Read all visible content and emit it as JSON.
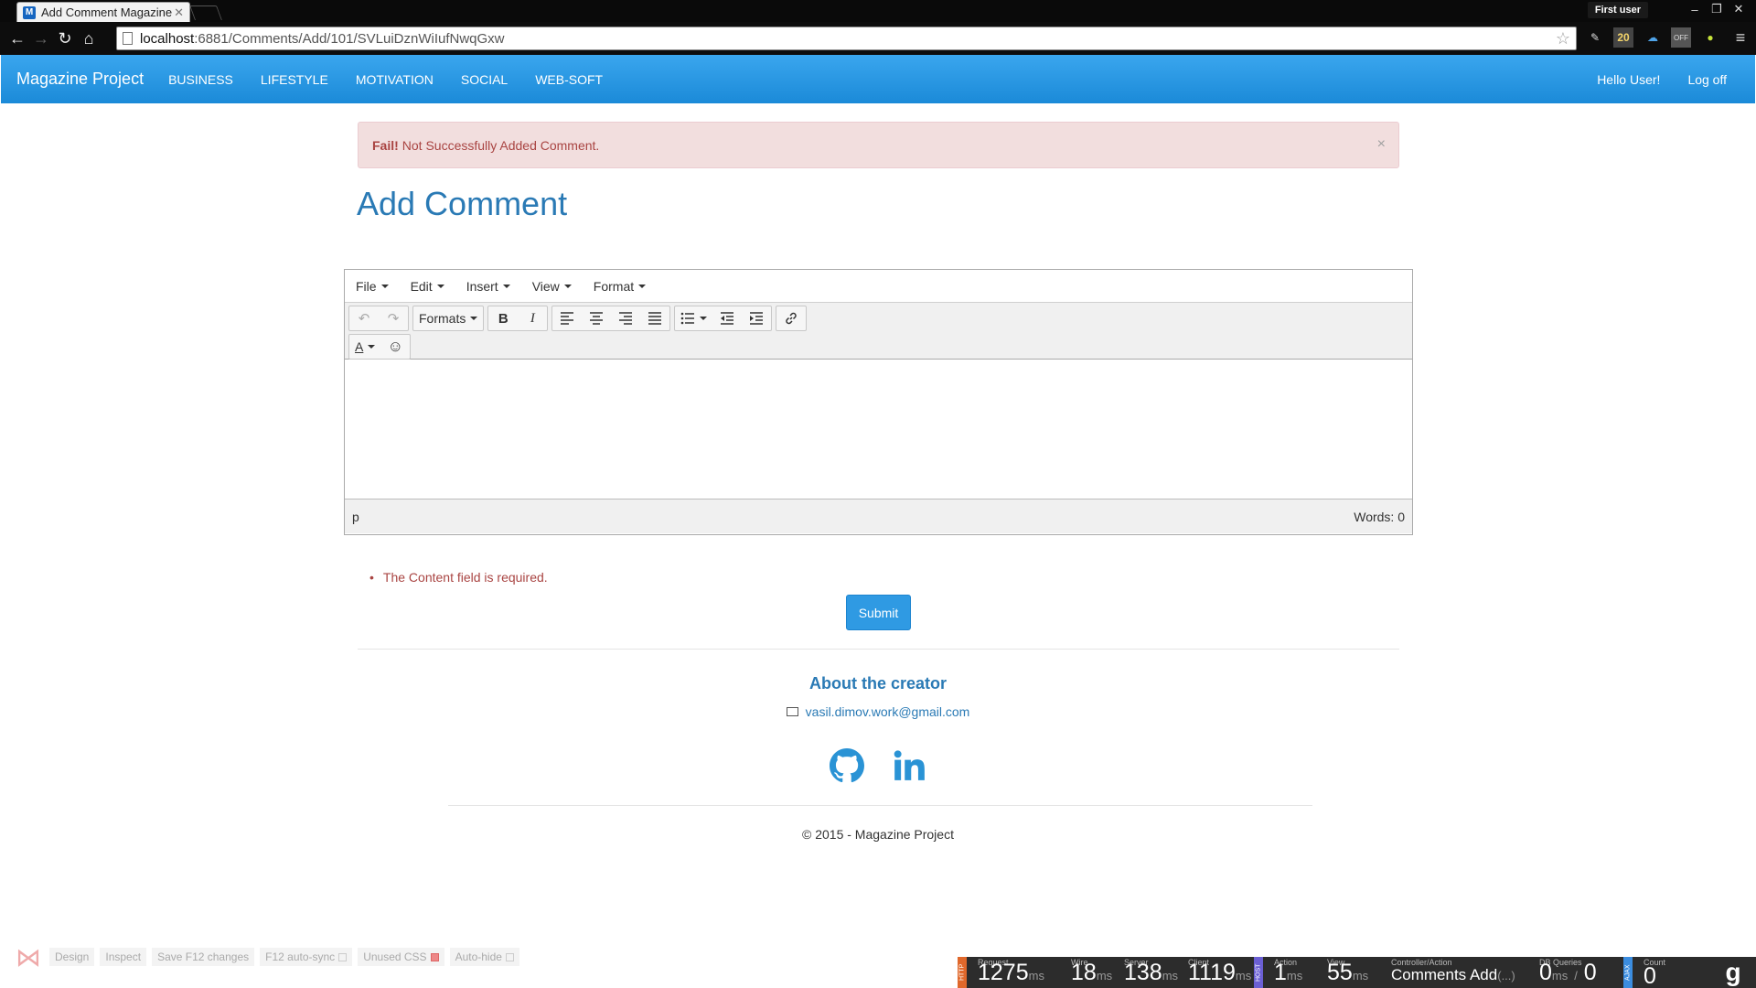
{
  "browser": {
    "tab_title": "Add Comment Magazine",
    "url_host": "localhost",
    "url_path": ":6881/Comments/Add/101/SVLuiDznWiIufNwqGxw",
    "user_badge": "First user",
    "ext_badge": "20",
    "ext_off": "OFF"
  },
  "nav": {
    "brand": "Magazine Project",
    "links": [
      "BUSINESS",
      "LIFESTYLE",
      "MOTIVATION",
      "SOCIAL",
      "WEB-SOFT"
    ],
    "hello": "Hello User!",
    "logoff": "Log off"
  },
  "alert": {
    "strong": "Fail!",
    "message": "Not Successfully Added Comment.",
    "close": "×"
  },
  "page": {
    "title": "Add Comment"
  },
  "editor": {
    "menus": [
      "File",
      "Edit",
      "Insert",
      "View",
      "Format"
    ],
    "formats_label": "Formats",
    "bold": "B",
    "italic": "I",
    "color_label": "A",
    "path": "p",
    "words": "Words: 0"
  },
  "form": {
    "validation_error": "The Content field is required.",
    "submit_label": "Submit"
  },
  "footer": {
    "about": "About the creator",
    "email": "vasil.dimov.work@gmail.com",
    "copyright": "© 2015 - Magazine Project"
  },
  "devtools": {
    "design": "Design",
    "inspect": "Inspect",
    "save": "Save F12 changes",
    "autosync": "F12 auto-sync",
    "unused_css": "Unused CSS",
    "autohide": "Auto-hide"
  },
  "glimpse": {
    "tag_http": "HTTP",
    "tag_host": "HOST",
    "tag_ajax": "AJAX",
    "request_label": "Request",
    "request_value": "1275",
    "ms": "ms",
    "wire_label": "Wire",
    "wire_value": "18",
    "server_label": "Server",
    "server_value": "138",
    "client_label": "Client",
    "client_value": "1119",
    "action_label": "Action",
    "action_value": "1",
    "view_label": "View",
    "view_value": "55",
    "ca_label": "Controller/Action",
    "ca_value": "Comments Add",
    "ca_suffix": "(...)",
    "db_label": "DB Queries",
    "db_value": "0",
    "db_sep": "/",
    "db_value2": "0",
    "count_label": "Count",
    "count_value": "0"
  }
}
